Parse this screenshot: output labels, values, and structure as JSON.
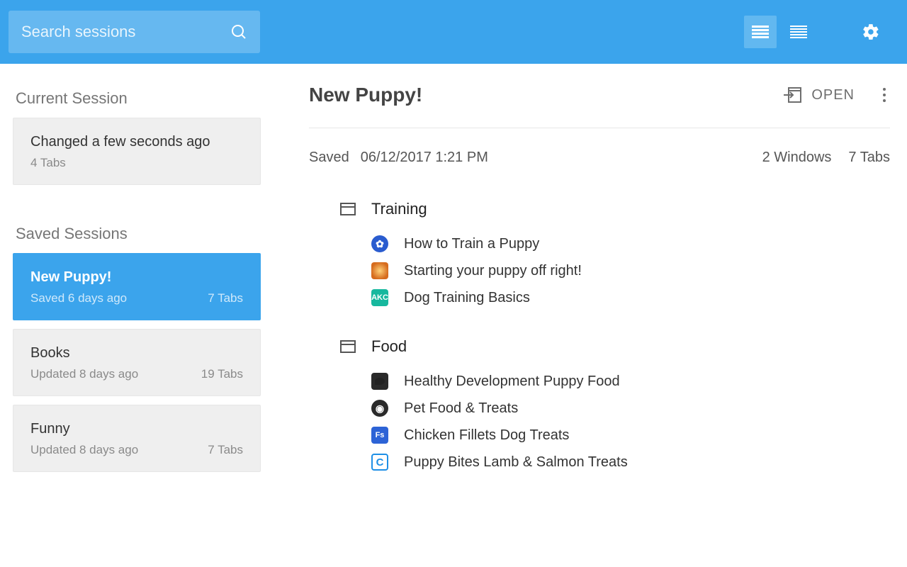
{
  "search": {
    "placeholder": "Search sessions"
  },
  "sidebar": {
    "current_head": "Current Session",
    "saved_head": "Saved Sessions",
    "current": {
      "title": "Changed a few seconds ago",
      "meta": "4 Tabs"
    },
    "saved": [
      {
        "title": "New Puppy!",
        "meta": "Saved 6 days ago",
        "tabs": "7 Tabs",
        "selected": true
      },
      {
        "title": "Books",
        "meta": "Updated 8 days ago",
        "tabs": "19 Tabs"
      },
      {
        "title": "Funny",
        "meta": "Updated 8 days ago",
        "tabs": "7 Tabs"
      }
    ]
  },
  "detail": {
    "title": "New Puppy!",
    "open_label": "OPEN",
    "saved_label": "Saved",
    "saved_ts": "06/12/2017 1:21 PM",
    "win_count": "2 Windows",
    "tab_count": "7 Tabs",
    "windows": [
      {
        "name": "Training",
        "tabs": [
          {
            "title": "How to Train a Puppy",
            "fav": "fv-blue"
          },
          {
            "title": "Starting your puppy off right!",
            "fav": "fv-orange"
          },
          {
            "title": "Dog Training Basics",
            "fav": "fv-teal",
            "txt": "AKC"
          }
        ]
      },
      {
        "name": "Food",
        "tabs": [
          {
            "title": "Healthy Development Puppy Food",
            "fav": "fv-dark"
          },
          {
            "title": "Pet Food & Treats",
            "fav": "fv-dark2"
          },
          {
            "title": "Chicken Fillets Dog Treats",
            "fav": "fv-fs",
            "txt": "Fs"
          },
          {
            "title": "Puppy Bites Lamb & Salmon Treats",
            "fav": "fv-c",
            "txt": "C"
          }
        ]
      }
    ]
  }
}
